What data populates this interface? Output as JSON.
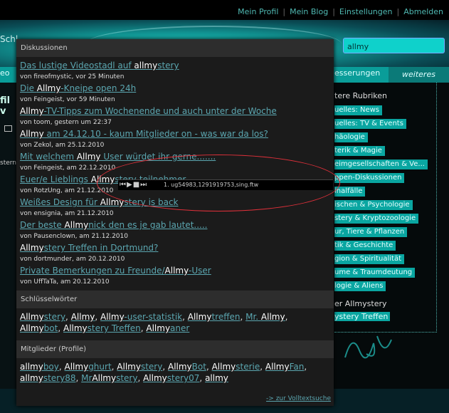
{
  "topnav": [
    "Mein Profil",
    "Mein Blog",
    "Einstellungen",
    "Abmelden"
  ],
  "header": {
    "left_text": "Schl",
    "search_value": "allmy"
  },
  "tabs": {
    "left": "eo",
    "right1": "esserungen",
    "right2": "weiteres"
  },
  "left_strip": {
    "t1": "fil v",
    "t2": "stern"
  },
  "right_panel": {
    "title": "tere Rubriken",
    "items": [
      "uelles: News",
      "uelles: TV & Events",
      "häologie",
      "terik & Magie",
      "eimgesellschaften & Ve...",
      "ppen-Diskussionen",
      "inalfälle",
      "ischen & Psychologie",
      "stery & Kryptozoologie",
      "ur, Tiere & Pflanzen",
      "tik & Geschichte",
      "gion & Spiritualität",
      "ume & Traumdeutung",
      "logie & Aliens"
    ],
    "sec2": "er Allmystery",
    "link2": "ystery Treffen"
  },
  "popup": {
    "sections": {
      "discussions": "Diskussionen",
      "keywords": "Schlüsselwörter",
      "members": "Mitglieder (Profile)"
    },
    "discussions": [
      {
        "pre": "Das lustige Videostadl auf ",
        "hl": "allmy",
        "post": "stery",
        "meta": "von fireofmystic, vor 25 Minuten"
      },
      {
        "pre": "Die ",
        "hl": "Allmy",
        "post": "-Kneipe open 24h",
        "meta": "von Feingeist, vor 59 Minuten"
      },
      {
        "pre": "",
        "hl": "Allmy",
        "post": "-TV-Tipps zum Wochenende und auch unter der Woche",
        "meta": "von toom, gestern um 22:37"
      },
      {
        "pre": "",
        "hl": "Allmy",
        "post": " am 24.12.10 - kaum Mitglieder on - was war da los?",
        "meta": "von Zekol, am 25.12.2010"
      },
      {
        "pre": "Mit welchem ",
        "hl": "Allmy",
        "post": " User würdet ihr gerne.......",
        "meta": "von Feingeist, am 22.12.2010"
      },
      {
        "pre": "Euer/e Lieblings ",
        "hl": "Allmy",
        "post": "stery-teilnehmer",
        "meta": "von RotzUng, am 21.12.2010"
      },
      {
        "pre": "Weißes Design für ",
        "hl": "Allmy",
        "post": "stery is back",
        "meta": "von ensignia, am 21.12.2010"
      },
      {
        "pre": "Der beste ",
        "hl": "Allmy",
        "post": "nick den es je gab lautet.....",
        "meta": "von Pausenclown, am 21.12.2010"
      },
      {
        "pre": "",
        "hl": "Allmy",
        "post": "stery Treffen in Dortmund?",
        "meta": "von dortmunder, am 20.12.2010"
      },
      {
        "pre": "Private Bemerkungen zu Freunde/",
        "hl": "Allmy",
        "post": "-User",
        "meta": "von UffTaTa, am 20.12.2010"
      }
    ],
    "keywords": [
      {
        "hl": "Allmy",
        "post": "stery"
      },
      {
        "hl": "Allmy",
        "post": ""
      },
      {
        "hl": "Allmy",
        "post": "-user-statistik"
      },
      {
        "hl": "Allmy",
        "post": "treffen"
      },
      {
        "hl": "Allmy",
        "post": "",
        "pre": "Mr. "
      },
      {
        "hl": "Allmy",
        "post": "bot"
      },
      {
        "hl": "Allmy",
        "post": "stery Treffen"
      },
      {
        "hl": "Allmy",
        "post": "aner"
      }
    ],
    "members": [
      {
        "pre": "",
        "hl": "allmy",
        "post": "boy"
      },
      {
        "pre": "",
        "hl": "Allmy",
        "post": "ghurt"
      },
      {
        "pre": "",
        "hl": "Allmy",
        "post": "stery"
      },
      {
        "pre": "",
        "hl": "Allmy",
        "post": "Bot"
      },
      {
        "pre": "",
        "hl": "Allmy",
        "post": "sterie"
      },
      {
        "pre": "",
        "hl": "Allmy",
        "post": "Fan"
      },
      {
        "pre": "",
        "hl": "allmy",
        "post": "stery88"
      },
      {
        "pre": "Mr",
        "hl": "Allmy",
        "post": "stery"
      },
      {
        "pre": "",
        "hl": "Allmy",
        "post": "stery07"
      },
      {
        "pre": "",
        "hl": "allmy",
        "post": ""
      }
    ],
    "volltext": "-> zur Volltextsuche"
  },
  "player": {
    "controls": "⏮▶■⏭",
    "track": "1. ug54983,1291919753,sing.ftw"
  },
  "colors": {
    "accent": "#0aa6a1",
    "link": "#5ba6b0",
    "annotation": "#e0303a"
  }
}
